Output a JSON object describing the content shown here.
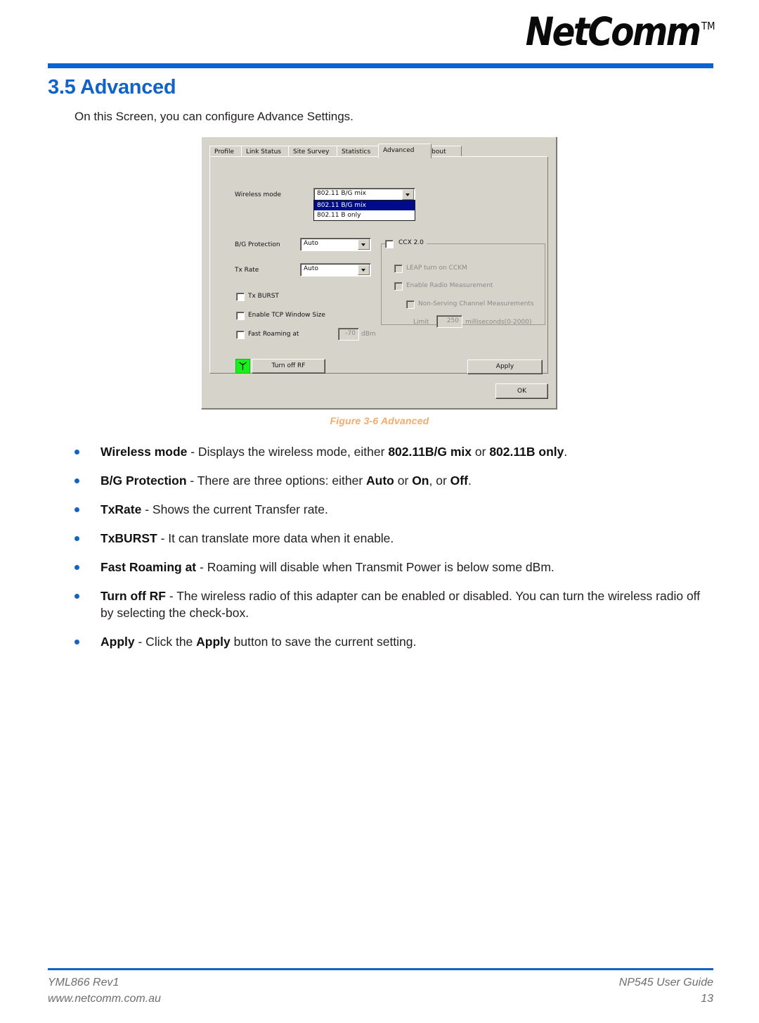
{
  "header": {
    "brand": "NetComm",
    "brand_tm": "TM"
  },
  "section": {
    "title": "3.5 Advanced",
    "intro": "On this Screen, you can configure Advance Settings."
  },
  "figure": {
    "caption": "Figure 3-6 Advanced",
    "dialog": {
      "tabs": [
        {
          "label": "Profile",
          "active": false
        },
        {
          "label": "Link Status",
          "active": false
        },
        {
          "label": "Site Survey",
          "active": false
        },
        {
          "label": "Statistics",
          "active": false
        },
        {
          "label": "Advanced",
          "active": true
        },
        {
          "label": "About",
          "active": false
        }
      ],
      "wireless_mode": {
        "label": "Wireless mode",
        "value": "802.11 B/G mix",
        "options": [
          "802.11 B/G mix",
          "802.11 B only"
        ],
        "selected_index": 0,
        "expanded": true
      },
      "bg_protection": {
        "label": "B/G Protection",
        "value": "Auto",
        "options": [
          "Auto",
          "On",
          "Off"
        ]
      },
      "tx_rate": {
        "label": "Tx Rate",
        "value": "Auto"
      },
      "tx_burst": {
        "label": "Tx BURST",
        "checked": false
      },
      "tcp_window": {
        "label": "Enable TCP Window Size",
        "checked": false
      },
      "fast_roaming": {
        "label": "Fast Roaming at",
        "checked": false,
        "value": "-70",
        "unit": "dBm"
      },
      "ccx": {
        "title": "CCX 2.0",
        "checked": false,
        "leap_cckm": {
          "label": "LEAP turn on CCKM",
          "checked": false
        },
        "radio_measurement": {
          "label": "Enable Radio Measurement",
          "checked": false
        },
        "non_serving": {
          "label": "Non-Serving Channel Measurements",
          "checked": false
        },
        "limit": {
          "label": "Limit",
          "value": "250",
          "unit": "milliseconds(0-2000)"
        }
      },
      "turn_off_rf_button": "Turn off RF",
      "apply_button": "Apply",
      "ok_button": "OK"
    }
  },
  "bullets": [
    {
      "term": "Wireless mode",
      "parts": [
        {
          "text": " - Displays the wireless mode, either ",
          "bold": false
        },
        {
          "text": "802.11B/G mix",
          "bold": true
        },
        {
          "text": " or ",
          "bold": false
        },
        {
          "text": "802.11B only",
          "bold": true
        },
        {
          "text": ".",
          "bold": false
        }
      ]
    },
    {
      "term": "B/G Protection",
      "parts": [
        {
          "text": " - There are three options: either ",
          "bold": false
        },
        {
          "text": "Auto",
          "bold": true
        },
        {
          "text": " or ",
          "bold": false
        },
        {
          "text": "On",
          "bold": true
        },
        {
          "text": ", or ",
          "bold": false
        },
        {
          "text": "Off",
          "bold": true
        },
        {
          "text": ".",
          "bold": false
        }
      ]
    },
    {
      "term": "TxRate",
      "parts": [
        {
          "text": " - Shows the current Transfer rate.",
          "bold": false
        }
      ]
    },
    {
      "term": "TxBURST",
      "parts": [
        {
          "text": " - It can translate more data when it enable.",
          "bold": false
        }
      ]
    },
    {
      "term": "Fast Roaming at",
      "parts": [
        {
          "text": " - Roaming will disable when Transmit Power is below some dBm.",
          "bold": false
        }
      ]
    },
    {
      "term": "Turn off RF",
      "parts": [
        {
          "text": " - The wireless radio of this adapter can be enabled or disabled. You can turn the wireless radio off by selecting the check-box.",
          "bold": false
        }
      ]
    },
    {
      "term": "Apply",
      "parts": [
        {
          "text": " - Click the ",
          "bold": false
        },
        {
          "text": "Apply",
          "bold": true
        },
        {
          "text": " button to save the current setting.",
          "bold": false
        }
      ]
    }
  ],
  "footer": {
    "doc_id": "YML866 Rev1",
    "website": "www.netcomm.com.au",
    "guide": "NP545 User Guide",
    "page_number": "13"
  },
  "colors": {
    "brand_blue": "#1263c6",
    "rule_blue": "#0b62d1",
    "caption_orange": "#f7ab6a",
    "dialog_face": "#d6d3cb",
    "highlight_navy": "#000a8c",
    "rf_green": "#19f019"
  }
}
